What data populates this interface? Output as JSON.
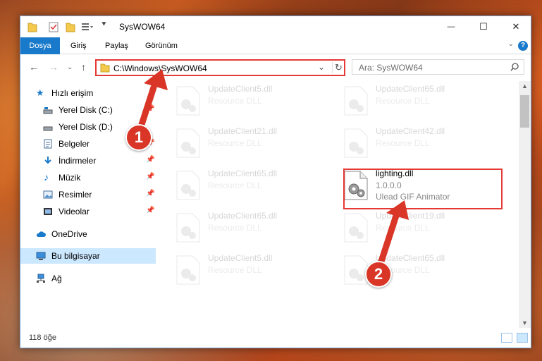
{
  "window": {
    "title": "SysWOW64",
    "controls": {
      "minimize": "—",
      "maximize": "☐",
      "close": "✕"
    }
  },
  "ribbon": {
    "tabs": [
      "Dosya",
      "Giriş",
      "Paylaş",
      "Görünüm"
    ],
    "help": "?"
  },
  "address": {
    "path": "C:\\Windows\\SysWOW64",
    "search_placeholder": "Ara: SysWOW64"
  },
  "nav": {
    "items": [
      {
        "label": "Hızlı erişim",
        "icon": "star-icon"
      },
      {
        "label": "Yerel Disk (C:)",
        "icon": "drive-icon"
      },
      {
        "label": "Yerel Disk (D:)",
        "icon": "drive-icon"
      },
      {
        "label": "Belgeler",
        "icon": "document-icon"
      },
      {
        "label": "İndirmeler",
        "icon": "download-icon"
      },
      {
        "label": "Müzik",
        "icon": "music-icon"
      },
      {
        "label": "Resimler",
        "icon": "picture-icon"
      },
      {
        "label": "Videolar",
        "icon": "video-icon"
      },
      {
        "label": "OneDrive",
        "icon": "cloud-icon"
      },
      {
        "label": "Bu bilgisayar",
        "icon": "computer-icon"
      },
      {
        "label": "Ağ",
        "icon": "network-icon"
      }
    ]
  },
  "files": [
    {
      "name": "UpdateClient5.dll",
      "type": "Resource DLL"
    },
    {
      "name": "UpdateClient65.dll",
      "type": "Resource DLL"
    },
    {
      "name": "UpdateClient21.dll",
      "type": "Resource DLL"
    },
    {
      "name": "UpdateClient42.dll",
      "type": "Resource DLL"
    },
    {
      "name": "UpdateClient65.dll",
      "type": "Resource DLL"
    },
    {
      "name": "lighting.dll",
      "version": "1.0.0.0",
      "type": "Ulead GIF Animator"
    },
    {
      "name": "UpdateClient65.dll",
      "type": "Resource DLL"
    },
    {
      "name": "UpdateClient19.dll",
      "type": "Resource DLL"
    },
    {
      "name": "UpdateClient5.dll",
      "type": "Resource DLL"
    },
    {
      "name": "UpdateClient65.dll",
      "type": "Resource DLL"
    }
  ],
  "status": {
    "count": "118 öğe"
  },
  "markers": [
    "1",
    "2"
  ],
  "colors": {
    "accent": "#1979ca",
    "highlight": "#e53935",
    "marker": "#d93628"
  }
}
